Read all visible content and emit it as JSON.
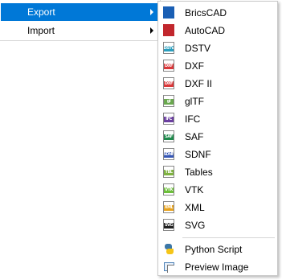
{
  "main_menu": {
    "items": [
      {
        "label": "Export",
        "highlighted": true
      },
      {
        "label": "Import",
        "highlighted": false
      }
    ]
  },
  "export_submenu": {
    "items": [
      {
        "label": "BricsCAD",
        "icon": "bricscad-icon",
        "icon_color": "#1a5fb4"
      },
      {
        "label": "AutoCAD",
        "icon": "autocad-icon",
        "icon_color": "#c1272d"
      },
      {
        "label": "DSTV",
        "icon": "dstv-file-icon",
        "icon_color": "#2a9fbf",
        "icon_text": "DSTV"
      },
      {
        "label": "DXF",
        "icon": "dxf-file-icon",
        "icon_color": "#d9383a",
        "icon_text": "DXF"
      },
      {
        "label": "DXF II",
        "icon": "dxf-ii-file-icon",
        "icon_color": "#d9383a",
        "icon_text": "DXF"
      },
      {
        "label": "glTF",
        "icon": "gltf-file-icon",
        "icon_color": "#6aa84f",
        "icon_text": "gl"
      },
      {
        "label": "IFC",
        "icon": "ifc-file-icon",
        "icon_color": "#6b3fa0",
        "icon_text": "IFC"
      },
      {
        "label": "SAF",
        "icon": "saf-file-icon",
        "icon_color": "#1f8a4c",
        "icon_text": "SAF"
      },
      {
        "label": "SDNF",
        "icon": "sdnf-file-icon",
        "icon_color": "#3556b5",
        "icon_text": "SDNF"
      },
      {
        "label": "Tables",
        "icon": "tables-file-icon",
        "icon_color": "#7fb241",
        "icon_text": "TBL"
      },
      {
        "label": "VTK",
        "icon": "vtk-file-icon",
        "icon_color": "#6cbf3a",
        "icon_text": "VTK"
      },
      {
        "label": "XML",
        "icon": "xml-file-icon",
        "icon_color": "#e8a21c",
        "icon_text": "XML"
      },
      {
        "label": "SVG",
        "icon": "svg-file-icon",
        "icon_color": "#222222",
        "icon_text": "SVG"
      },
      {
        "label": "Python Script",
        "icon": "python-icon"
      },
      {
        "label": "Preview Image",
        "icon": "preview-image-icon"
      }
    ]
  },
  "colors": {
    "highlight": "#0078d7",
    "separator": "#d6d6d6"
  }
}
